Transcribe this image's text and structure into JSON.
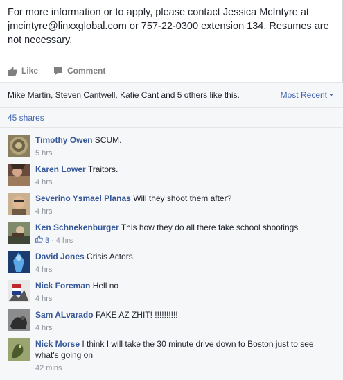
{
  "post": {
    "text": "For more information or to apply, please contact Jessica McIntyre at jmcintyre@linxxglobal.com or 757-22-0300 extension 134. Resumes are not necessary."
  },
  "actions": {
    "like_label": "Like",
    "comment_label": "Comment"
  },
  "likes": {
    "summary": "Mike Martin, Steven Cantwell, Katie Cant and 5 others like this.",
    "sort_label": "Most Recent"
  },
  "shares": {
    "label": "45 shares"
  },
  "comments": [
    {
      "author": "Timothy Owen",
      "text": "SCUM.",
      "time": "5 hrs",
      "likes": ""
    },
    {
      "author": "Karen Lower",
      "text": "Traitors.",
      "time": "4 hrs",
      "likes": ""
    },
    {
      "author": "Severino Ysmael Planas",
      "text": "Will they shoot them after?",
      "time": "4 hrs",
      "likes": ""
    },
    {
      "author": "Ken Schnekenburger",
      "text": "This how they do all there fake school shootings",
      "time": "4 hrs",
      "likes": "3"
    },
    {
      "author": "David Jones",
      "text": "Crisis Actors.",
      "time": "4 hrs",
      "likes": ""
    },
    {
      "author": "Nick Foreman",
      "text": "Hell no",
      "time": "4 hrs",
      "likes": ""
    },
    {
      "author": "Sam ALvarado",
      "text": "FAKE AZ ZHIT! !!!!!!!!!!",
      "time": "4 hrs",
      "likes": ""
    },
    {
      "author": "Nick Morse",
      "text": "I think I will take the 30 minute drive down to Boston just to see what's going on",
      "time": "42 mins",
      "likes": ""
    }
  ],
  "icons": {
    "like": "thumbs-up-icon",
    "comment": "speech-bubble-icon",
    "sort": "caret-down-icon"
  },
  "colors": {
    "link": "#365899",
    "accent": "#4267b2",
    "muted": "#90949c",
    "panel": "#f6f7f9"
  }
}
